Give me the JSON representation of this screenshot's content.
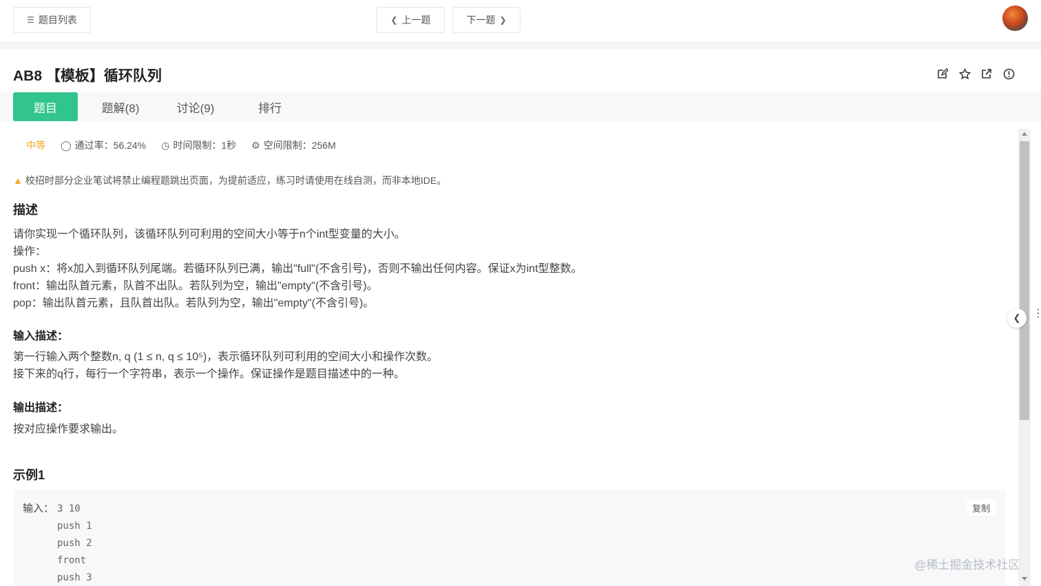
{
  "topbar": {
    "list_button": "题目列表",
    "prev_button": "上一题",
    "next_button": "下一题"
  },
  "problem": {
    "title": "AB8 【模板】循环队列",
    "tabs": [
      "题目",
      "题解(8)",
      "讨论(9)",
      "排行"
    ],
    "difficulty": "中等",
    "pass_rate": "通过率：56.24%",
    "time_limit": "时间限制：1秒",
    "memory_limit": "空间限制：256M",
    "warning": "校招时部分企业笔试将禁止编程题跳出页面，为提前适应，练习时请使用在线自测，而非本地IDE。",
    "description_heading": "描述",
    "description_lines": [
      "请你实现一个循环队列，该循环队列可利用的空间大小等于n个int型变量的大小。",
      "操作：",
      "push x：将x加入到循环队列尾端。若循环队列已满，输出\"full\"(不含引号)，否则不输出任何内容。保证x为int型整数。",
      "front：输出队首元素，队首不出队。若队列为空，输出\"empty\"(不含引号)。",
      "pop：输出队首元素，且队首出队。若队列为空，输出\"empty\"(不含引号)。"
    ],
    "input_heading": "输入描述：",
    "input_lines": [
      "第一行输入两个整数n, q (1 ≤ n, q ≤ 10⁵)，表示循环队列可利用的空间大小和操作次数。",
      "接下来的q行，每行一个字符串，表示一个操作。保证操作是题目描述中的一种。"
    ],
    "output_heading": "输出描述：",
    "output_text": "按对应操作要求输出。",
    "example_heading": "示例1",
    "example_input_label": "输入：",
    "example_lines": [
      "3 10",
      "push 1",
      "push 2",
      "front",
      "push 3"
    ],
    "copy_button": "复制"
  },
  "watermark": "@稀土掘金技术社区",
  "icons": {
    "list": "list-icon",
    "prev": "chevron-left-icon",
    "next": "chevron-right-icon",
    "edit": "edit-icon",
    "star": "star-icon",
    "share": "external-link-icon",
    "report": "info-icon"
  },
  "colors": {
    "accent": "#32c48d",
    "difficulty": "#f5a623"
  }
}
